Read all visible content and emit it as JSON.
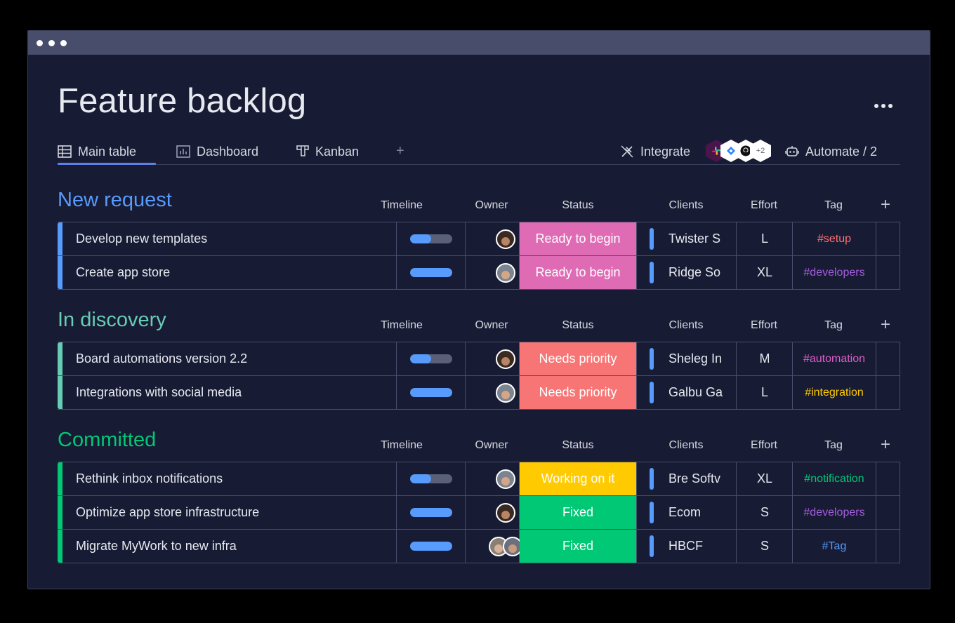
{
  "window": {
    "title": "Feature backlog"
  },
  "tabs": [
    {
      "label": "Main table",
      "icon": "table-icon",
      "active": true
    },
    {
      "label": "Dashboard",
      "icon": "chart-icon",
      "active": false
    },
    {
      "label": "Kanban",
      "icon": "kanban-icon",
      "active": false
    }
  ],
  "integrate": {
    "label": "Integrate",
    "icons": [
      "slack-icon",
      "jira-icon",
      "github-icon"
    ],
    "more": "+2"
  },
  "automate": {
    "label": "Automate / 2"
  },
  "columns": {
    "timeline": "Timeline",
    "owner": "Owner",
    "status": "Status",
    "clients": "Clients",
    "effort": "Effort",
    "tag": "Tag"
  },
  "colors": {
    "ready": "#e05cb1",
    "needs": "#f87575",
    "working": "#ffcb00",
    "fixed": "#00c875",
    "group_new": "#579bfc",
    "group_discovery": "#66ccb4",
    "group_committed": "#00c875"
  },
  "groups": [
    {
      "title": "New request",
      "color": "#579bfc",
      "rows": [
        {
          "name": "Develop new templates",
          "timeline": 0.5,
          "owner": "woman-avatar",
          "status": "Ready to begin",
          "status_color": "#e06bb5",
          "client": "Twister S",
          "effort": "L",
          "tag": "#setup",
          "tag_color": "#ff6f6f"
        },
        {
          "name": "Create app store",
          "timeline": 1.0,
          "owner": "man-avatar",
          "status": "Ready to begin",
          "status_color": "#e06bb5",
          "client": "Ridge So",
          "effort": "XL",
          "tag": "#developers",
          "tag_color": "#a25ddc"
        }
      ]
    },
    {
      "title": "In discovery",
      "color": "#66ccb4",
      "rows": [
        {
          "name": "Board automations version 2.2",
          "timeline": 0.5,
          "owner": "woman-avatar",
          "status": "Needs priority",
          "status_color": "#f87575",
          "client": "Sheleg In",
          "effort": "M",
          "tag": "#automation",
          "tag_color": "#e05cc9"
        },
        {
          "name": "Integrations with social media",
          "timeline": 1.0,
          "owner": "man-avatar",
          "status": "Needs priority",
          "status_color": "#f87575",
          "client": "Galbu Ga",
          "effort": "L",
          "tag": "#integration",
          "tag_color": "#ffcb00"
        }
      ]
    },
    {
      "title": "Committed",
      "color": "#00c875",
      "rows": [
        {
          "name": "Rethink inbox notifications",
          "timeline": 0.5,
          "owner": "man-avatar",
          "status": "Working on it",
          "status_color": "#ffcb00",
          "client": "Bre Softv",
          "effort": "XL",
          "tag": "#notification",
          "tag_color": "#00c875"
        },
        {
          "name": "Optimize app store infrastructure",
          "timeline": 1.0,
          "owner": "woman-avatar",
          "status": "Fixed",
          "status_color": "#00c875",
          "client": "Ecom",
          "effort": "S",
          "tag": "#developers",
          "tag_color": "#a25ddc"
        },
        {
          "name": "Migrate MyWork to new infra",
          "timeline": 1.0,
          "owner": "two-avatars",
          "status": "Fixed",
          "status_color": "#00c875",
          "client": "HBCF",
          "effort": "S",
          "tag": "#Tag",
          "tag_color": "#579bfc"
        }
      ]
    }
  ]
}
